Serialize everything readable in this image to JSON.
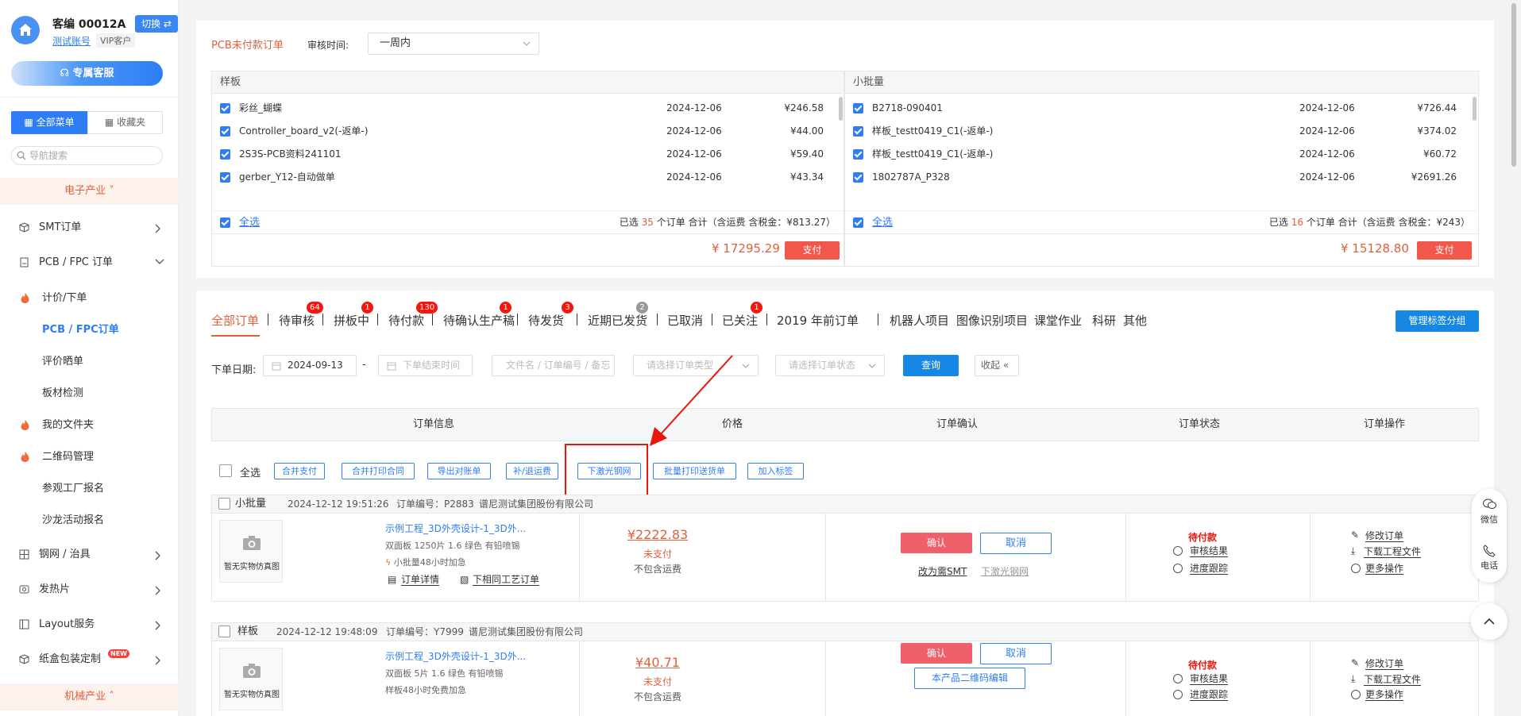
{
  "sidebar": {
    "customer_name": "客编 00012A",
    "switch_label": "切换 ⇄",
    "test_account": "测试账号",
    "vip_label": "VIP客户",
    "service_btn": "专属客服",
    "tab_all": "全部菜单",
    "tab_fav": "收藏夹",
    "search_placeholder": "导航搜索",
    "cat_electronics": "电子产业",
    "cat_machinery": "机械产业",
    "items": [
      {
        "label": "SMT订单"
      },
      {
        "label": "PCB / FPC 订单"
      },
      {
        "label": "计价/下单"
      },
      {
        "label": "PCB / FPC订单"
      },
      {
        "label": "评价晒单"
      },
      {
        "label": "板材检测"
      },
      {
        "label": "我的文件夹"
      },
      {
        "label": "二维码管理"
      },
      {
        "label": "参观工厂报名"
      },
      {
        "label": "沙龙活动报名"
      },
      {
        "label": "钢网 / 治具"
      },
      {
        "label": "发热片"
      },
      {
        "label": "Layout服务"
      },
      {
        "label": "纸盒包装定制"
      }
    ],
    "new_badge": "NEW"
  },
  "unpaid": {
    "title": "PCB未付款订单",
    "time_label": "审核时间:",
    "time_value": "一周内",
    "groups": [
      {
        "name": "样板",
        "rows": [
          {
            "name": "彩丝_蝴蝶",
            "date": "2024-12-06",
            "amount": "¥246.58"
          },
          {
            "name": "Controller_board_v2(-返单-)",
            "date": "2024-12-06",
            "amount": "¥44.00"
          },
          {
            "name": "2S3S-PCB资料241101",
            "date": "2024-12-06",
            "amount": "¥59.40"
          },
          {
            "name": "gerber_Y12-自动做单",
            "date": "2024-12-06",
            "amount": "¥43.34"
          }
        ],
        "select_all": "全选",
        "summary_prefix": "已选",
        "count": "35",
        "summary_suffix": "个订单 合计（含运费 含税金：¥813.27）",
        "total": "¥ 17295.29",
        "pay": "支付"
      },
      {
        "name": "小批量",
        "rows": [
          {
            "name": "B2718-090401",
            "date": "2024-12-06",
            "amount": "¥726.44"
          },
          {
            "name": "样板_testt0419_C1(-返单-)",
            "date": "2024-12-06",
            "amount": "¥374.02"
          },
          {
            "name": "样板_testt0419_C1(-返单-)",
            "date": "2024-12-06",
            "amount": "¥60.72"
          },
          {
            "name": "1802787A_P328",
            "date": "2024-12-06",
            "amount": "¥2691.26"
          }
        ],
        "select_all": "全选",
        "summary_prefix": "已选",
        "count": "16",
        "summary_suffix": "个订单 合计（含运费 含税金：¥243）",
        "total": "¥ 15128.80",
        "pay": "支付"
      }
    ]
  },
  "orders": {
    "tabs": [
      {
        "label": "全部订单"
      },
      {
        "label": "待审核",
        "badge": "64"
      },
      {
        "label": "拼板中",
        "badge": "1"
      },
      {
        "label": "待付款",
        "badge": "130"
      },
      {
        "label": "待确认生产稿",
        "badge": "1"
      },
      {
        "label": "待发货",
        "badge": "3"
      },
      {
        "label": "近期已发货",
        "badge": "2"
      },
      {
        "label": "已取消"
      },
      {
        "label": "已关注",
        "badge": "1"
      },
      {
        "label": "2019 年前订单"
      },
      {
        "label": "机器人项目"
      },
      {
        "label": "图像识别项目"
      },
      {
        "label": "课堂作业"
      },
      {
        "label": "科研"
      },
      {
        "label": "其他"
      }
    ],
    "manage_tags": "管理标签分组",
    "filter": {
      "date_label": "下单日期:",
      "start_date": "2024-09-13",
      "dash": "-",
      "end_placeholder": "下单结束时间",
      "keyword_placeholder": "文件名 / 订单编号 / 备忘",
      "type_placeholder": "请选择订单类型",
      "status_placeholder": "请选择订单状态",
      "query": "查询",
      "collapse": "收起"
    },
    "columns": [
      "订单信息",
      "价格",
      "订单确认",
      "订单状态",
      "订单操作"
    ],
    "bulk": {
      "select_all": "全选",
      "buttons": [
        "合并支付",
        "合并打印合同",
        "导出对账单",
        "补/退运费",
        "下激光钢网",
        "批量打印送货单",
        "加入标签"
      ]
    },
    "list": [
      {
        "type": "小批量",
        "time": "2024-12-12 19:51:26",
        "order_no": "订单编号：P2883",
        "company": "谱尼测试集团股份有限公司",
        "thumb_text": "暂无实物仿真图",
        "title": "示例工程_3D外壳设计-1_3D外...",
        "spec": "双面板   1250片   1.6   绿色   有铅喷锡",
        "note": "小批量48小时加急",
        "link1": "订单详情",
        "link2": "下相同工艺订单",
        "price": "¥2222.83",
        "pay_status": "未支付",
        "ship_note": "不包含运费",
        "confirm": "确认",
        "cancel": "取消",
        "extra_link1": "改为需SMT",
        "extra_link2": "下激光钢网",
        "status": "待付款",
        "status_link1": "审核结果",
        "status_link2": "进度跟踪",
        "op1": "修改订单",
        "op2": "下载工程文件",
        "op3": "更多操作"
      },
      {
        "type": "样板",
        "time": "2024-12-12 19:48:09",
        "order_no": "订单编号：Y7999",
        "company": "谱尼测试集团股份有限公司",
        "thumb_text": "暂无实物仿真图",
        "title": "示例工程_3D外壳设计-1_3D外...",
        "spec": "双面板   5片   1.6   绿色   有铅喷锡",
        "note": "样板48小时免费加急",
        "price": "¥40.71",
        "pay_status": "未支付",
        "ship_note": "不包含运费",
        "confirm": "确认",
        "cancel": "取消",
        "qr_btn": "本产品二维码编辑",
        "status": "待付款",
        "status_link1": "审核结果",
        "status_link2": "进度跟踪",
        "op1": "修改订单",
        "op2": "下载工程文件",
        "op3": "更多操作"
      }
    ]
  },
  "float": {
    "wechat": "微信",
    "phone": "电话"
  },
  "colors": {
    "accent_blue": "#2e7cf6",
    "accent_orange": "#e0603c",
    "badge_red": "#f5160e",
    "highlight_box": "#e8160c"
  }
}
